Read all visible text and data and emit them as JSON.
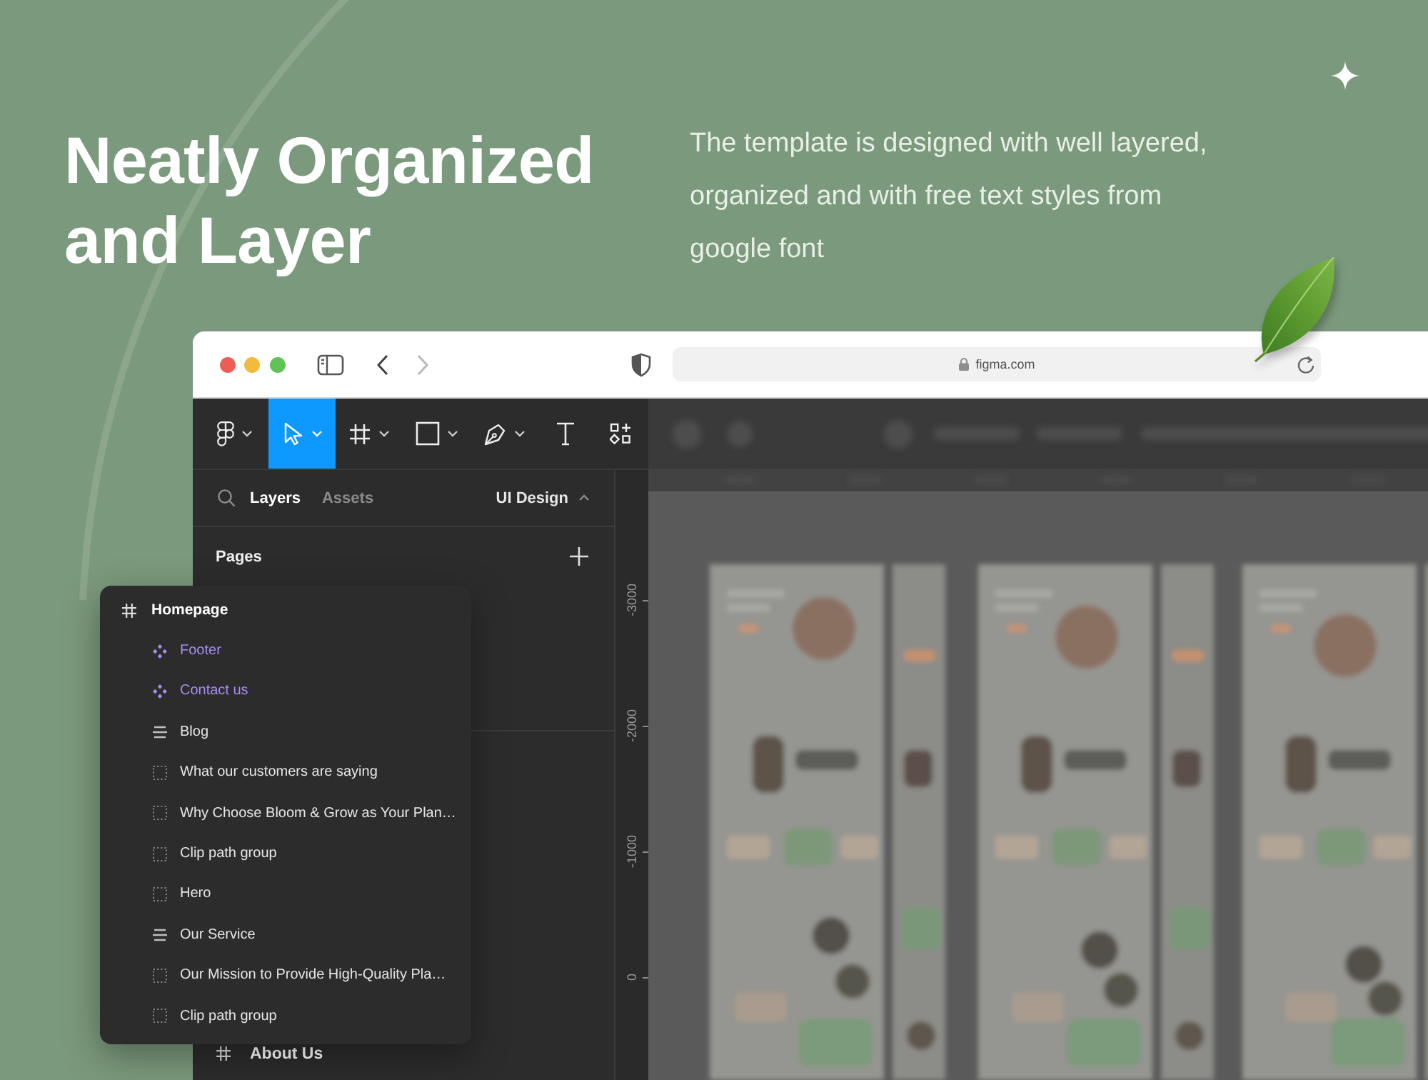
{
  "hero": {
    "title": "Neatly Organized and Layer",
    "description": "The template is designed with well layered, organized and with free text styles from google font"
  },
  "browser": {
    "nav": [
      {
        "kind": "back",
        "disabled": false
      },
      {
        "kind": "forward",
        "disabled": true
      }
    ],
    "address": "figma.com"
  },
  "toolbar": {
    "tools": [
      {
        "kind": "logo",
        "selected": false,
        "menu": true
      },
      {
        "kind": "move",
        "selected": true,
        "menu": true
      },
      {
        "kind": "frame",
        "selected": false,
        "menu": true
      },
      {
        "kind": "shape",
        "selected": false,
        "menu": true
      },
      {
        "kind": "pen",
        "selected": false,
        "menu": true
      },
      {
        "kind": "text",
        "selected": false,
        "menu": false
      },
      {
        "kind": "actions",
        "selected": false,
        "menu": false
      }
    ]
  },
  "layers_panel": {
    "tabs": [
      {
        "label": "Layers",
        "selected": true
      },
      {
        "label": "Assets",
        "selected": false
      }
    ],
    "page_menu": {
      "label": "UI Design",
      "expanded": true
    },
    "pages_heading": "Pages",
    "layers": [
      {
        "name": "About Us",
        "kind": "frame"
      }
    ]
  },
  "ruler": {
    "marks": [
      "-3000",
      "-2000",
      "-1000",
      "0"
    ]
  },
  "layer_popup": {
    "layers": [
      {
        "name": "Homepage",
        "kind": "frame",
        "children": [
          {
            "name": "Footer",
            "kind": "component"
          },
          {
            "name": "Contact us",
            "kind": "component"
          },
          {
            "name": "Blog",
            "kind": "autolayout"
          },
          {
            "name": "What our customers are saying",
            "kind": "group"
          },
          {
            "name": "Why Choose Bloom & Grow as Your Plan…",
            "kind": "group"
          },
          {
            "name": "Clip path group",
            "kind": "group"
          },
          {
            "name": "Hero",
            "kind": "group"
          },
          {
            "name": "Our Service",
            "kind": "autolayout"
          },
          {
            "name": "Our Mission to Provide High-Quality Pla…",
            "kind": "group"
          },
          {
            "name": "Clip path group",
            "kind": "group"
          }
        ]
      }
    ]
  }
}
